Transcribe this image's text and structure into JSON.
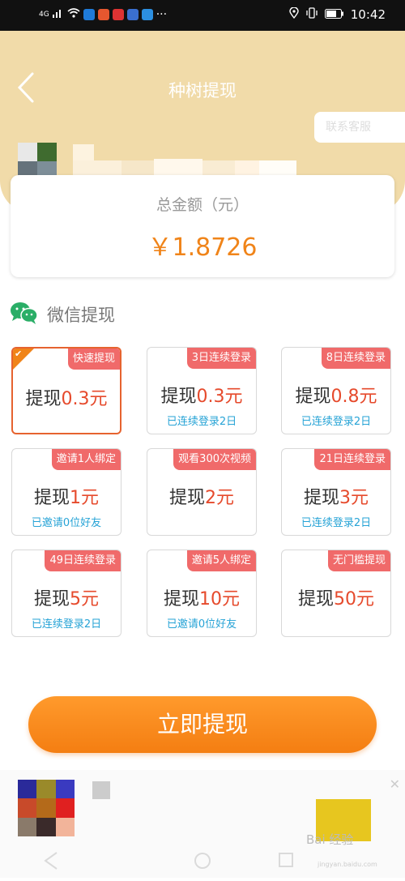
{
  "status_bar": {
    "signal": "4G",
    "time": "10:42",
    "more": "···"
  },
  "header": {
    "title": "种树提现",
    "contact_label": "联系客服"
  },
  "balance": {
    "label": "总金额（元）",
    "value": "￥1.8726"
  },
  "section": {
    "label": "微信提现"
  },
  "options": [
    {
      "tag": "快速提现",
      "prefix": "提现",
      "amount": "0.3元",
      "sub": "",
      "selected": true
    },
    {
      "tag": "3日连续登录",
      "prefix": "提现",
      "amount": "0.3元",
      "sub": "已连续登录2日",
      "selected": false
    },
    {
      "tag": "8日连续登录",
      "prefix": "提现",
      "amount": "0.8元",
      "sub": "已连续登录2日",
      "selected": false
    },
    {
      "tag": "邀请1人绑定",
      "prefix": "提现",
      "amount": "1元",
      "sub": "已邀请0位好友",
      "selected": false
    },
    {
      "tag": "观看300次视频",
      "prefix": "提现",
      "amount": "2元",
      "sub": "",
      "selected": false
    },
    {
      "tag": "21日连续登录",
      "prefix": "提现",
      "amount": "3元",
      "sub": "已连续登录2日",
      "selected": false
    },
    {
      "tag": "49日连续登录",
      "prefix": "提现",
      "amount": "5元",
      "sub": "已连续登录2日",
      "selected": false
    },
    {
      "tag": "邀请5人绑定",
      "prefix": "提现",
      "amount": "10元",
      "sub": "已邀请0位好友",
      "selected": false
    },
    {
      "tag": "无门槛提现",
      "prefix": "提现",
      "amount": "50元",
      "sub": "",
      "selected": false
    }
  ],
  "action": {
    "withdraw_label": "立即提现"
  },
  "watermark": {
    "text": "Bai 经验",
    "sub": "jingyan.baidu.com"
  },
  "colors": {
    "header_bg": "#f1dba9",
    "accent_orange": "#f08419",
    "tag_red": "#f06a6a",
    "amount_red": "#e64a2c",
    "sub_blue": "#26a3d6",
    "wechat_green": "#2aae67"
  }
}
